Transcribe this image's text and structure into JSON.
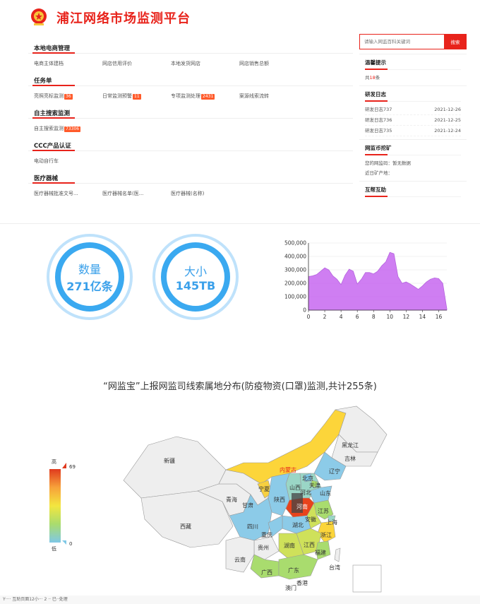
{
  "header": {
    "site_title": "浦江网络市场监测平台"
  },
  "sections": [
    {
      "title": "本地电商管理",
      "items": [
        {
          "label": "电商主体建档",
          "badge": ""
        },
        {
          "label": "网店信用评价",
          "badge": ""
        },
        {
          "label": "本地发货网店",
          "badge": ""
        },
        {
          "label": "网店销售总额",
          "badge": ""
        }
      ]
    },
    {
      "title": "任务单",
      "items": [
        {
          "label": "亮照亮标监测",
          "badge": "36"
        },
        {
          "label": "日常监测预警",
          "badge": "11"
        },
        {
          "label": "专项监测处理",
          "badge": "2431"
        },
        {
          "label": "案源线索流转",
          "badge": ""
        }
      ]
    },
    {
      "title": "自主搜索监测",
      "items": [
        {
          "label": "自主搜索监测",
          "badge": "73306"
        }
      ]
    },
    {
      "title": "CCC产品认证",
      "items": [
        {
          "label": "电动自行车",
          "badge": ""
        }
      ]
    },
    {
      "title": "医疗器械",
      "items": [
        {
          "label": "医疗器械批准文号...",
          "badge": ""
        },
        {
          "label": "医疗器械名单(医...",
          "badge": ""
        },
        {
          "label": "医疗器械(名称)",
          "badge": ""
        }
      ]
    }
  ],
  "search": {
    "placeholder": "请输入网监百科关键词",
    "button": "搜索"
  },
  "tips": {
    "title": "温馨提示",
    "prefix": "共",
    "count": "18",
    "suffix": "条"
  },
  "devlog": {
    "title": "研发日志",
    "entries": [
      {
        "name": "研发日志737",
        "date": "2021-12-26"
      },
      {
        "name": "研发日志736",
        "date": "2021-12-25"
      },
      {
        "name": "研发日志735",
        "date": "2021-12-24"
      }
    ]
  },
  "mining": {
    "title": "网监币挖矿",
    "line1": "您的网监码：暂无数据",
    "line2": "近日矿产地："
  },
  "mutual": {
    "title": "互帮互助"
  },
  "stats": [
    {
      "label": "数量",
      "value": "271亿条"
    },
    {
      "label": "大小",
      "value": "145TB"
    }
  ],
  "chart_data": {
    "type": "area",
    "x": [
      0,
      0.5,
      1,
      1.5,
      2,
      2.5,
      3,
      3.5,
      4,
      4.5,
      5,
      5.5,
      6,
      6.5,
      7,
      7.5,
      8,
      8.5,
      9,
      9.5,
      10,
      10.5,
      11,
      11.5,
      12,
      12.5,
      13,
      13.5,
      14,
      14.5,
      15,
      15.5,
      16,
      16.5,
      17
    ],
    "values": [
      250000,
      255000,
      265000,
      290000,
      315000,
      300000,
      255000,
      230000,
      190000,
      260000,
      305000,
      290000,
      195000,
      230000,
      280000,
      280000,
      270000,
      290000,
      330000,
      360000,
      430000,
      420000,
      250000,
      200000,
      210000,
      195000,
      175000,
      155000,
      180000,
      210000,
      230000,
      240000,
      235000,
      200000,
      10000
    ],
    "xticks": [
      0,
      2,
      4,
      6,
      8,
      10,
      12,
      14,
      16
    ],
    "yticks": [
      "0",
      "100,000",
      "200,000",
      "300,000",
      "400,000",
      "500,000"
    ],
    "ylim": [
      0,
      500000
    ],
    "xlim": [
      0,
      17
    ],
    "color": "#c45ef0"
  },
  "map": {
    "title": "“网监宝”上报网监司线索属地分布(防疫物资(口罩)监测,共计255条)",
    "legend_high": "高",
    "legend_low": "低",
    "legend_max": "69",
    "legend_min": "0",
    "provinces": [
      "新疆",
      "西藏",
      "青海",
      "甘肃",
      "内蒙古",
      "宁夏",
      "陕西",
      "四川",
      "重庆",
      "云南",
      "贵州",
      "广西",
      "广东",
      "湖南",
      "湖北",
      "江西",
      "福建",
      "浙江",
      "上海",
      "江苏",
      "安徽",
      "山东",
      "河南",
      "山西",
      "河北",
      "北京",
      "天津",
      "辽宁",
      "吉林",
      "黑龙江",
      "香港",
      "澳门",
      "台湾"
    ]
  },
  "footer": {
    "text": "Y···· 互助页面12小··· 2 ·· 已··处理"
  }
}
